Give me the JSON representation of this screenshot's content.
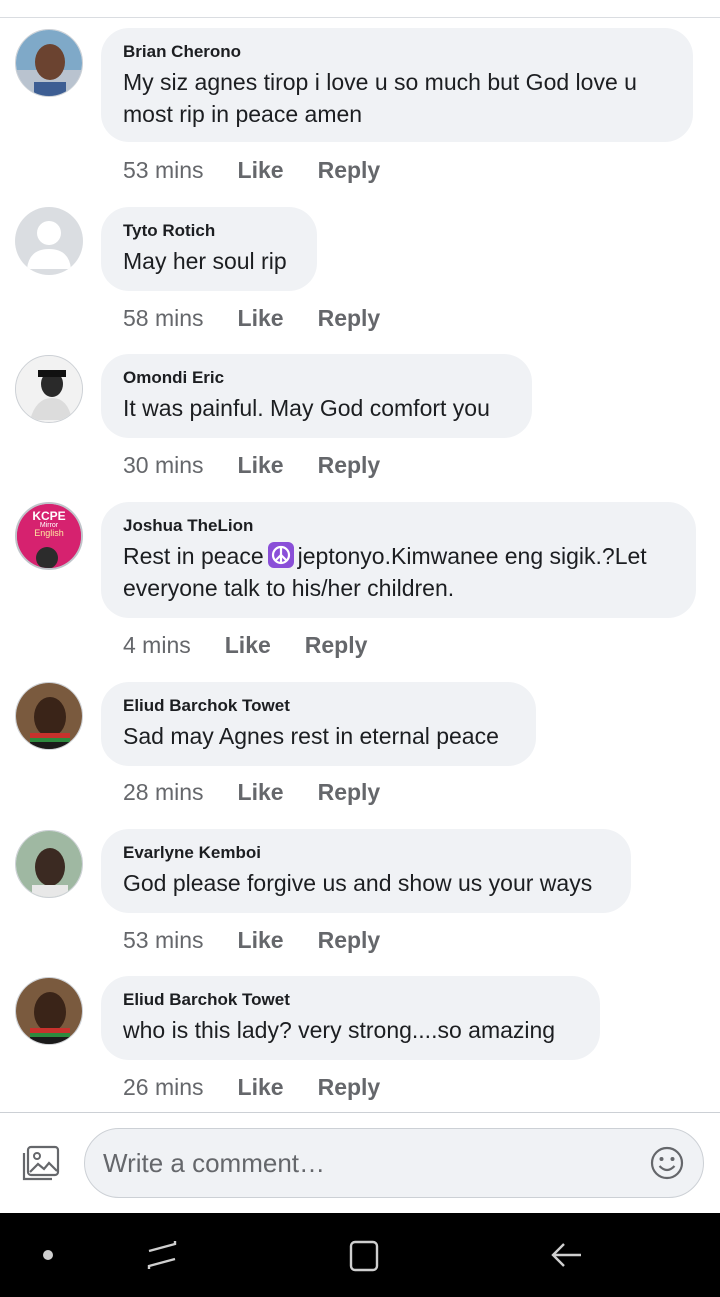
{
  "comments": [
    {
      "author": "Brian Cherono",
      "text": "My siz agnes tirop  i love u so much but God  love u most rip in peace amen",
      "time": "53 mins",
      "like": "Like",
      "reply": "Reply",
      "avatar": "photo-avatar"
    },
    {
      "author": "Tyto Rotich",
      "text": "May her soul rip",
      "time": "58 mins",
      "like": "Like",
      "reply": "Reply",
      "avatar": "default-avatar"
    },
    {
      "author": "Omondi Eric",
      "text": "It was painful. May God comfort you",
      "time": "30 mins",
      "like": "Like",
      "reply": "Reply",
      "avatar": "photo-avatar"
    },
    {
      "author": "Joshua TheLion",
      "text_before": "Rest in peace",
      "text_after": "jeptonyo.Kimwanee eng sigik.?Let everyone talk to his/her children.",
      "emoji": "peace-symbol-emoji",
      "time": "4 mins",
      "like": "Like",
      "reply": "Reply",
      "avatar": "kcpe-avatar",
      "avatar_text": [
        "KCPE",
        "Mirror",
        "English"
      ]
    },
    {
      "author": "Eliud Barchok Towet",
      "text": "Sad may Agnes rest in eternal peace",
      "time": "28 mins",
      "like": "Like",
      "reply": "Reply",
      "avatar": "photo-avatar"
    },
    {
      "author": "Evarlyne Kemboi",
      "text": "God please forgive us and show us your ways",
      "time": "53 mins",
      "like": "Like",
      "reply": "Reply",
      "avatar": "photo-avatar"
    },
    {
      "author": "Eliud Barchok Towet",
      "text": "who is this lady? very strong....so amazing",
      "time": "26 mins",
      "like": "Like",
      "reply": "Reply",
      "avatar": "photo-avatar"
    }
  ],
  "composer": {
    "placeholder": "Write a comment…",
    "gallery_icon": "photo-gallery-icon",
    "emoji_icon": "emoji-icon"
  },
  "navbar": {
    "icons": [
      "dot-icon",
      "recent-apps-icon",
      "home-icon",
      "back-icon"
    ]
  },
  "colors": {
    "bubble": "#f0f2f5",
    "meta": "#65676b",
    "text": "#1c1e21",
    "navbar": "#000000",
    "emoji_purple": "#8a4fd8"
  }
}
